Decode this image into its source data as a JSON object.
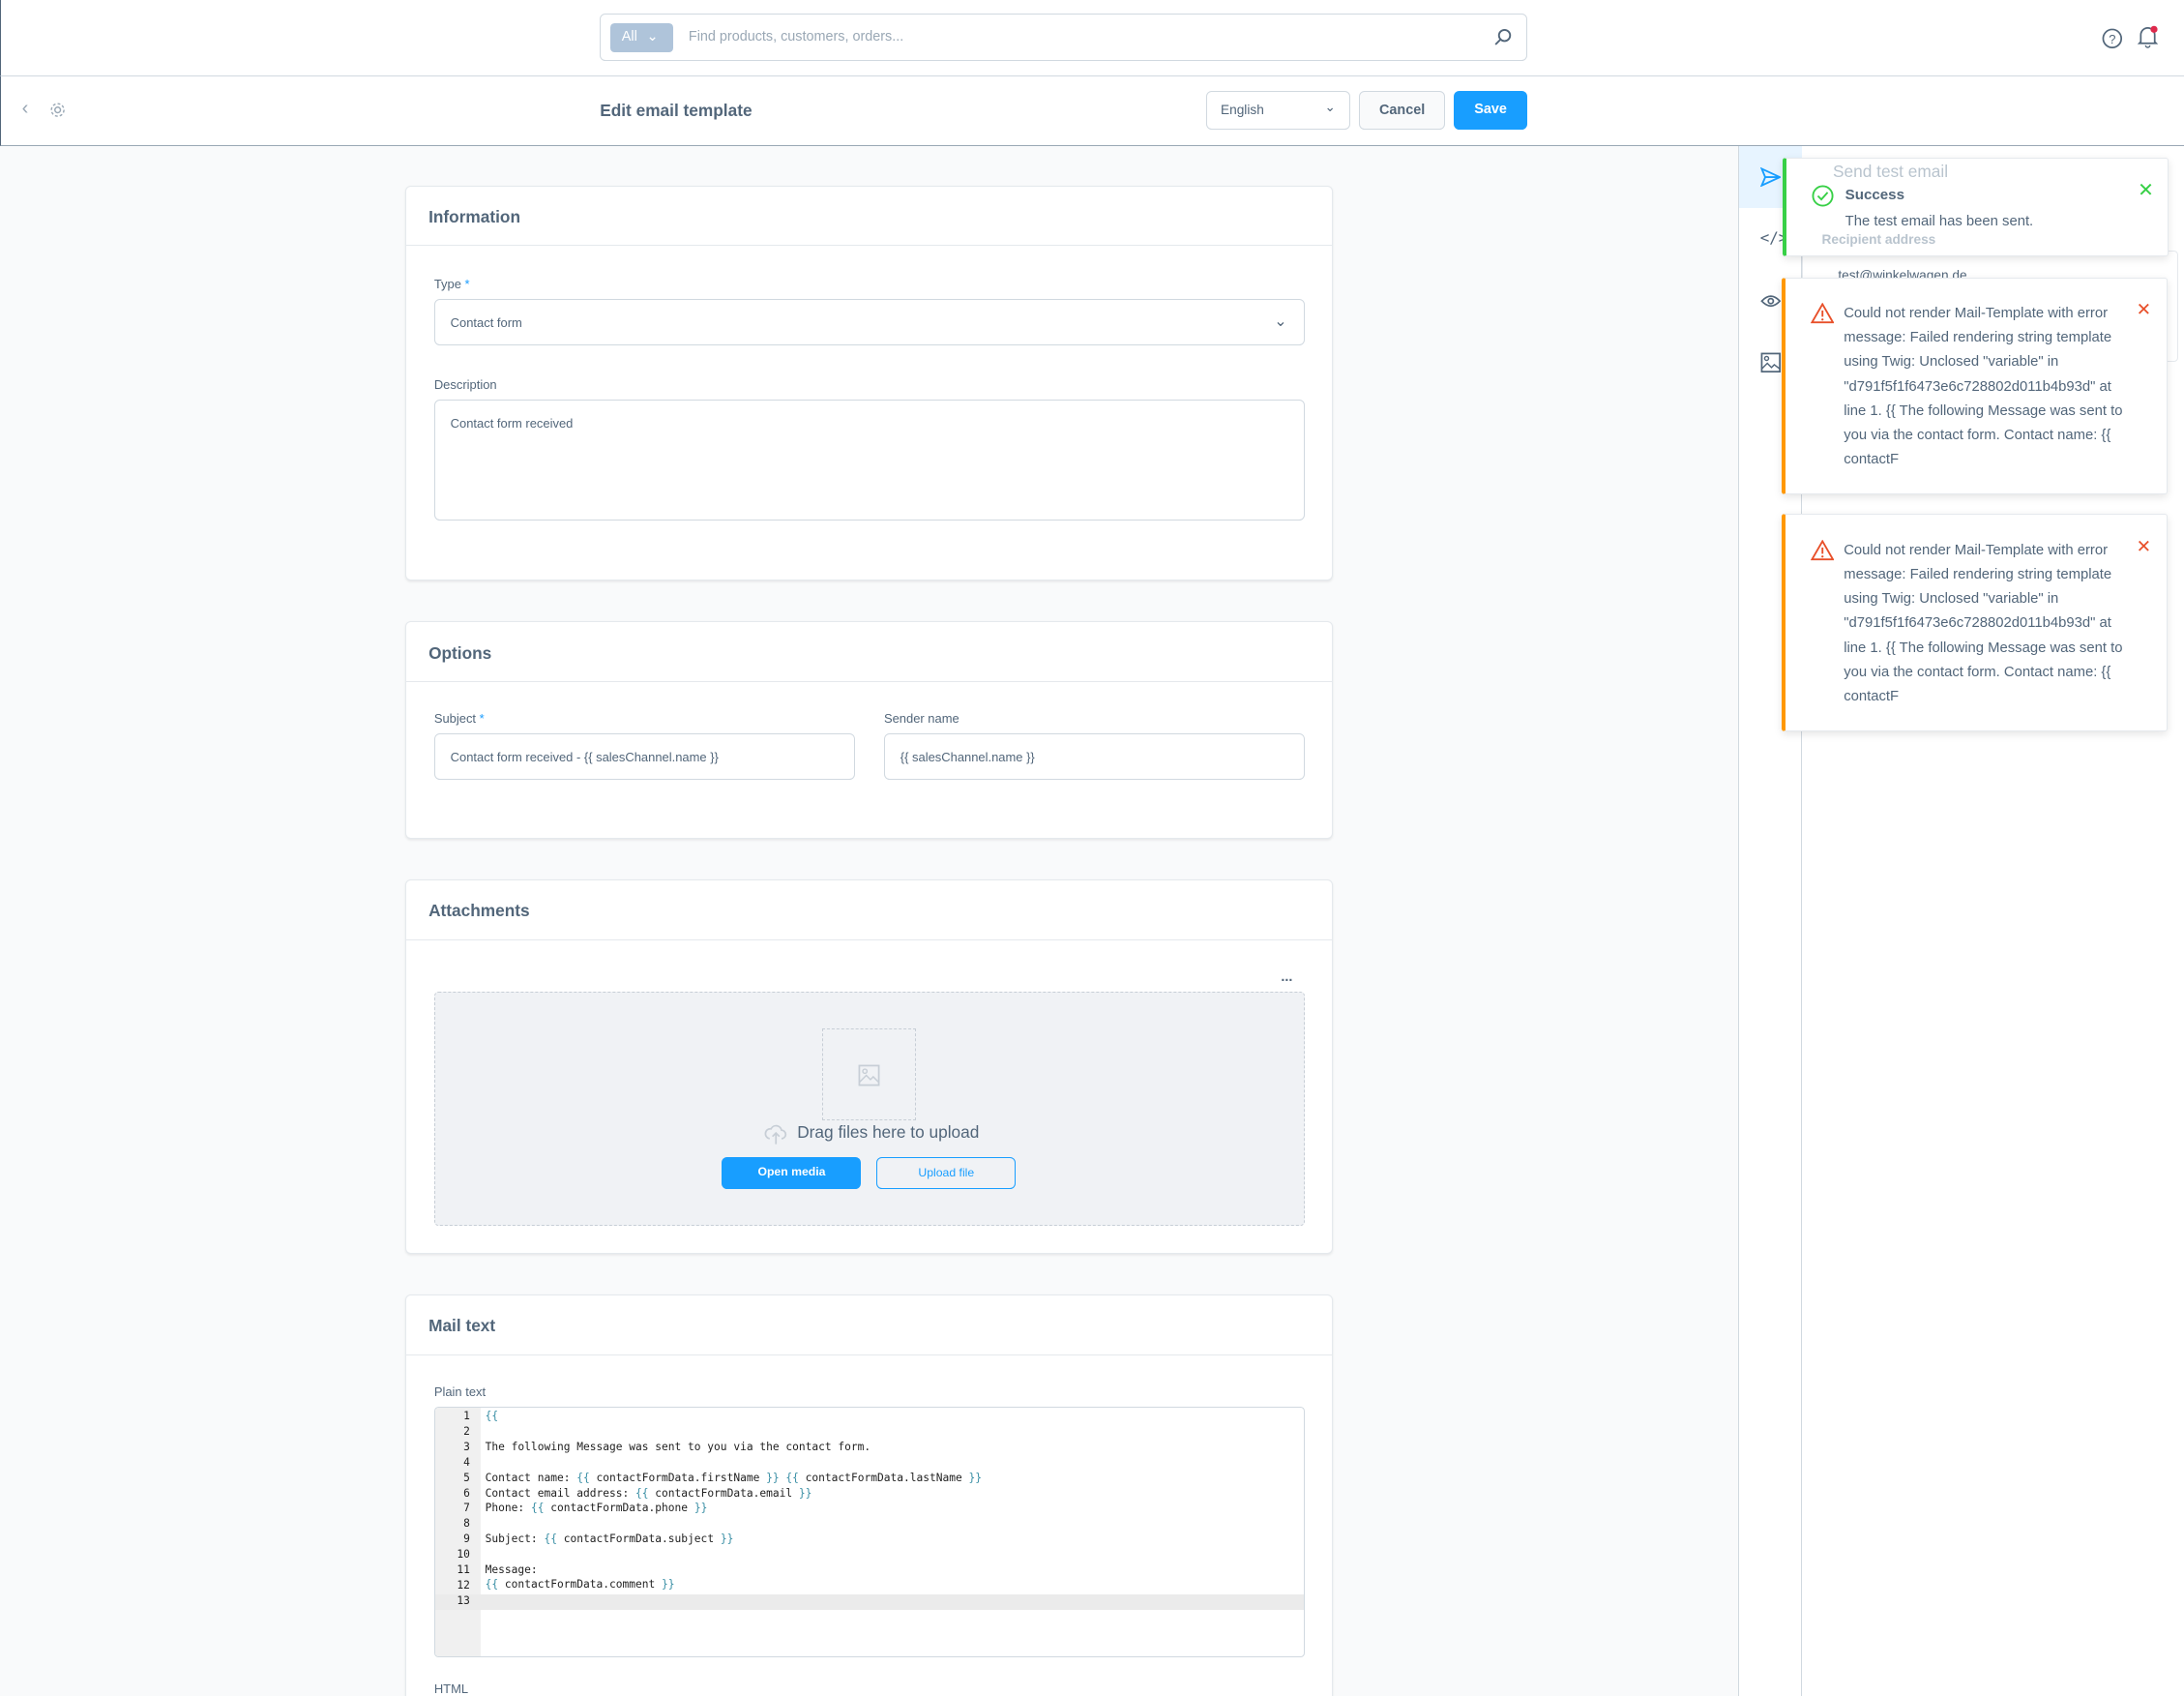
{
  "header": {
    "search_scope": "All",
    "search_placeholder": "Find products, customers, orders..."
  },
  "toolbar": {
    "title": "Edit email template",
    "language": "English",
    "cancel_label": "Cancel",
    "save_label": "Save"
  },
  "information": {
    "title": "Information",
    "type_label": "Type",
    "type_value": "Contact form",
    "description_label": "Description",
    "description_value": "Contact form received"
  },
  "options": {
    "title": "Options",
    "subject_label": "Subject",
    "subject_value": "Contact form received - {{ salesChannel.name }}",
    "sender_label": "Sender name",
    "sender_value": "{{ salesChannel.name }}"
  },
  "attachments": {
    "title": "Attachments",
    "more": "...",
    "drop_text": "Drag files here to upload",
    "open_media": "Open media",
    "upload_file": "Upload file"
  },
  "mail_text": {
    "title": "Mail text",
    "plain_label": "Plain text",
    "html_label": "HTML",
    "lines": [
      "{{",
      "",
      "The following Message was sent to you via the contact form.",
      "",
      "Contact name: {{ contactFormData.firstName }} {{ contactFormData.lastName }}",
      "Contact email address: {{ contactFormData.email }}",
      "Phone: {{ contactFormData.phone }}",
      "",
      "Subject: {{ contactFormData.subject }}",
      "",
      "Message:",
      "{{ contactFormData.comment }}",
      ""
    ]
  },
  "side_panel": {
    "title": "Send test email",
    "recipient_label": "Recipient address",
    "recipient_value": "test@winkelwagen.de"
  },
  "toasts": [
    {
      "type": "success",
      "title": "Success",
      "message": "The test email has been sent.",
      "color": "#37d046"
    },
    {
      "type": "error",
      "message": "Could not render Mail-Template with error message: Failed rendering string template using Twig: Unclosed \"variable\" in \"d791f5f1f6473e6c728802d011b4b93d\" at line 1. {{ The following Message was sent to you via the contact form. Contact name: {{ contactF",
      "color": "#ff9800"
    },
    {
      "type": "error",
      "message": "Could not render Mail-Template with error message: Failed rendering string template using Twig: Unclosed \"variable\" in \"d791f5f1f6473e6c728802d011b4b93d\" at line 1. {{ The following Message was sent to you via the contact form. Contact name: {{ contactF",
      "color": "#ff9800"
    }
  ],
  "colors": {
    "primary": "#189eff",
    "text": "#52667a",
    "success": "#37d046",
    "warning": "#ff9800",
    "error_icon": "#de294c"
  }
}
